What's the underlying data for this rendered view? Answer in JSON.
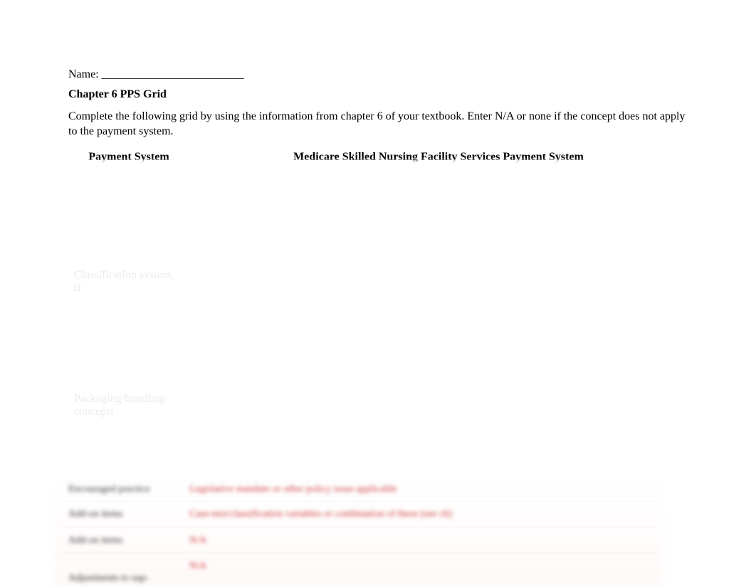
{
  "name_label": "Name: _________________________",
  "title": "Chapter 6 PPS Grid",
  "instructions": "Complete the following grid by using the information from chapter 6 of your textbook. Enter N/A or none if the concept does not apply to the payment system.",
  "table": {
    "headers": {
      "col1": "Payment System",
      "col2": "Medicare Skilled Nursing Facility Services Payment System"
    },
    "rows": [
      {
        "label": "",
        "value": ""
      },
      {
        "label": "Classification system, if",
        "value": ""
      },
      {
        "label": "",
        "value": ""
      },
      {
        "label": "Packaging/bundling concepts",
        "value": ""
      },
      {
        "label": "",
        "value": ""
      }
    ]
  },
  "obscured": {
    "r1": {
      "label": "Encouraged practice",
      "value": "Legislative mandate or other policy issue applicable"
    },
    "r2": {
      "label": "Add-on items",
      "value": "Case-mix/classification variables or combination of these (see ch)"
    },
    "r3": {
      "label": "Add-on items",
      "value": "N/A"
    },
    "r4": {
      "label": "",
      "value": "N/A"
    },
    "r5": {
      "label": "Adjustments to sup-",
      "value": ""
    }
  }
}
